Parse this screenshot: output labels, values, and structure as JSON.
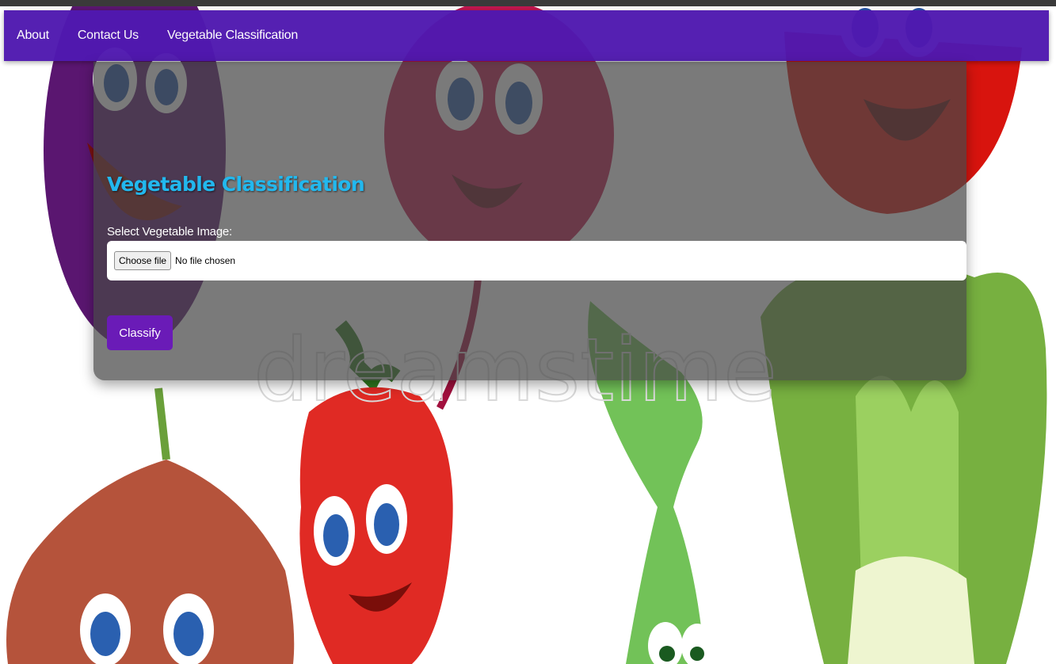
{
  "nav": {
    "items": [
      {
        "label": "About"
      },
      {
        "label": "Contact Us"
      },
      {
        "label": "Vegetable Classification"
      }
    ]
  },
  "card": {
    "title": "Vegetable Classification",
    "field_label": "Select Vegetable Image:",
    "file_input": {
      "button_label": "Choose file",
      "status": "No file chosen"
    },
    "submit_label": "Classify"
  },
  "colors": {
    "navbar": "#5019b0",
    "title": "#22b8ee",
    "button": "#6a1bb7"
  },
  "background": {
    "watermark": "dreamstime"
  }
}
